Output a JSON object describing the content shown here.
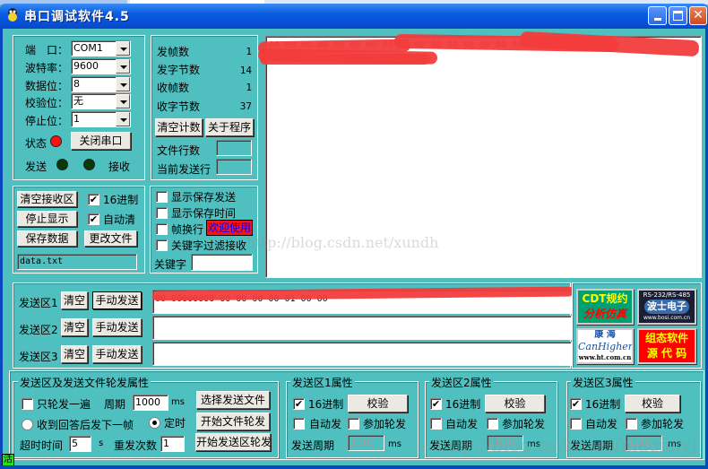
{
  "window": {
    "title": "串口调试软件4.5",
    "buttons": {
      "minimize": "_",
      "maximize": "□",
      "close": "✕"
    }
  },
  "port_settings": {
    "port_label": "端　口：",
    "port_value": "COM1",
    "baud_label": "波特率：",
    "baud_value": "9600",
    "databits_label": "数据位：",
    "databits_value": "8",
    "parity_label": "校验位：",
    "parity_value": "无",
    "stopbits_label": "停止位：",
    "stopbits_value": "1",
    "status_label": "状态",
    "status_color": "#ff0000",
    "close_port_button": "关闭串口",
    "send_label": "发送",
    "receive_label": "接收",
    "send_led_color": "#0a3a0a",
    "receive_led_color": "#0a3a0a"
  },
  "counters": {
    "sent_frames_label": "发帧数",
    "sent_frames": "1",
    "sent_bytes_label": "发字节数",
    "sent_bytes": "14",
    "recv_frames_label": "收帧数",
    "recv_frames": "1",
    "recv_bytes_label": "收字节数",
    "recv_bytes": "37",
    "clear_count_button": "清空计数",
    "about_button": "关于程序",
    "file_lines_label": "文件行数",
    "file_lines_value": "",
    "current_line_label": "当前发送行",
    "current_line_value": ""
  },
  "receive_area": {
    "line1": "00 00 00 00 00 00 00 00 00 00 00 00 00 00 00 00 00",
    "line2": "00 00 00 00 00 00 00 00",
    "watermark": "http://blog.csdn.net/xundh"
  },
  "receive_controls": {
    "clear_receive_button": "清空接收区",
    "hex_label": "16进制",
    "hex_checked": true,
    "stop_display_button": "停止显示",
    "auto_clear_label": "自动清",
    "auto_clear_checked": true,
    "save_data_button": "保存数据",
    "change_file_button": "更改文件",
    "filename": "data.txt"
  },
  "display_options": {
    "show_save_send": {
      "label": "显示保存发送",
      "checked": false
    },
    "show_save_time": {
      "label": "显示保存时间",
      "checked": false
    },
    "frame_newline": {
      "label": "帧换行",
      "checked": false
    },
    "welcome_badge": "欢迎使用",
    "keyword_filter": {
      "label": "关键字过滤接收",
      "checked": false
    },
    "keyword_label": "关键字",
    "keyword_value": ""
  },
  "send_areas": [
    {
      "label": "发送区1",
      "clear": "清空",
      "send": "手动发送",
      "content": "00 00000000 00 00 00 00    01       00 00"
    },
    {
      "label": "发送区2",
      "clear": "清空",
      "send": "手动发送",
      "content": ""
    },
    {
      "label": "发送区3",
      "clear": "清空",
      "send": "手动发送",
      "content": ""
    }
  ],
  "ads": {
    "cdt": {
      "line1": "CDT规约",
      "line2": "分析仿真"
    },
    "bosi": {
      "line1": "RS-232/RS-485",
      "line2": "波士电子",
      "line3": "www.bosi.com.cn"
    },
    "kanghai": {
      "line1": "康 海",
      "line2": "CanHigher",
      "line3": "www.ht.com.cn"
    },
    "zutai": {
      "line1": "组态软件",
      "line2": "源 代 码"
    }
  },
  "cycle_props": {
    "title": "发送区及发送文件轮发属性",
    "once_label": "只轮发一遍",
    "once_checked": false,
    "period_label": "周期",
    "period_value": "1000",
    "period_unit": "ms",
    "select_file_button": "选择发送文件",
    "reply_next_label": "收到回答后发下一帧",
    "reply_next_selected": false,
    "timed_label": "定时",
    "timed_selected": true,
    "start_file_cycle_button": "开始文件轮发",
    "timeout_label": "超时时间",
    "timeout_value": "5",
    "timeout_unit": "s",
    "retry_label": "重发次数",
    "retry_value": "1",
    "start_area_cycle_button": "开始发送区轮发"
  },
  "area_props": [
    {
      "title": "发送区1属性",
      "hex_label": "16进制",
      "hex_checked": true,
      "verify_button": "校验",
      "auto_send_label": "自动发",
      "auto_send_checked": false,
      "join_cycle_label": "参加轮发",
      "join_cycle_checked": false,
      "period_label": "发送周期",
      "period_value": "1000",
      "period_unit": "ms"
    },
    {
      "title": "发送区2属性",
      "hex_label": "16进制",
      "hex_checked": true,
      "verify_button": "校验",
      "auto_send_label": "自动发",
      "auto_send_checked": false,
      "join_cycle_label": "参加轮发",
      "join_cycle_checked": false,
      "period_label": "发送周期",
      "period_value": "1000",
      "period_unit": "ms"
    },
    {
      "title": "发送区3属性",
      "hex_label": "16进制",
      "hex_checked": true,
      "verify_button": "校验",
      "auto_send_label": "自动发",
      "auto_send_checked": false,
      "join_cycle_label": "参加轮发",
      "join_cycle_checked": false,
      "period_label": "发送周期",
      "period_value": "1000",
      "period_unit": "ms"
    }
  ],
  "status_bar": {
    "indicator": "活"
  },
  "watermark_bottom": "http://blog.csdn.net/magiclyj",
  "checkmark": "✔"
}
